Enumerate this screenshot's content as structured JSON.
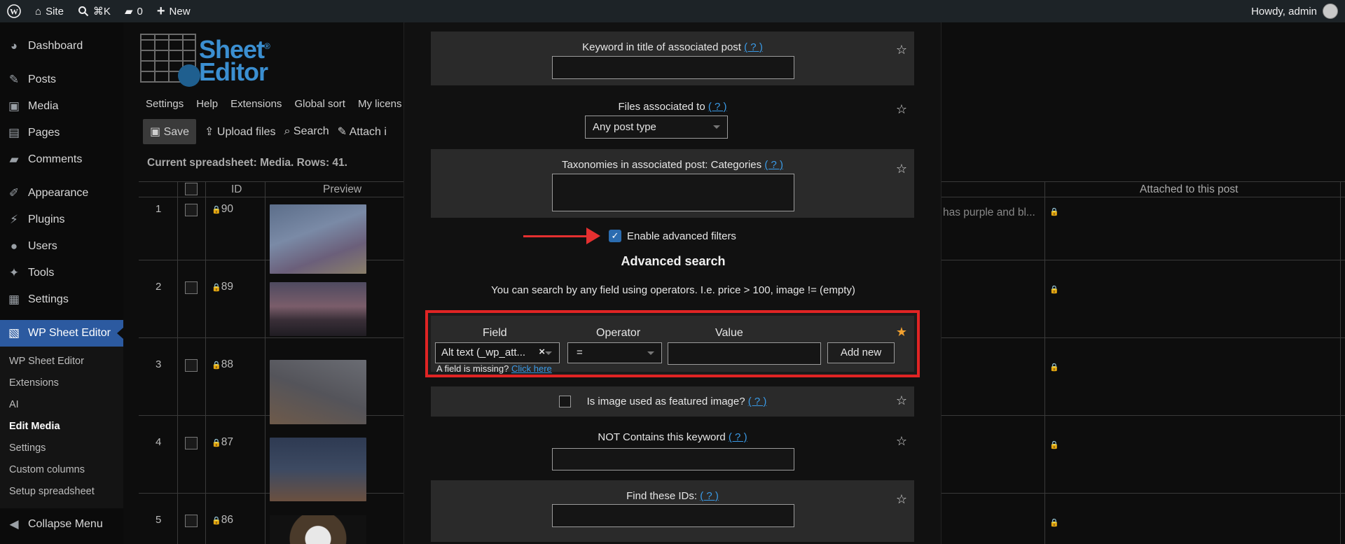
{
  "adminbar": {
    "site": "Site",
    "shortcut": "⌘K",
    "comments_count": "0",
    "new": "New",
    "howdy": "Howdy, admin"
  },
  "sidebar": {
    "items": [
      {
        "label": "Dashboard",
        "icon": "dashboard-icon",
        "glyph": "◕"
      },
      {
        "label": "Posts",
        "icon": "pin-icon",
        "glyph": "✎"
      },
      {
        "label": "Media",
        "icon": "media-icon",
        "glyph": "▣"
      },
      {
        "label": "Pages",
        "icon": "pages-icon",
        "glyph": "▤"
      },
      {
        "label": "Comments",
        "icon": "comment-icon",
        "glyph": "▰"
      },
      {
        "label": "Appearance",
        "icon": "brush-icon",
        "glyph": "✐"
      },
      {
        "label": "Plugins",
        "icon": "plug-icon",
        "glyph": "⚡"
      },
      {
        "label": "Users",
        "icon": "user-icon",
        "glyph": "●"
      },
      {
        "label": "Tools",
        "icon": "wrench-icon",
        "glyph": "✦"
      },
      {
        "label": "Settings",
        "icon": "settings-icon",
        "glyph": "▦"
      },
      {
        "label": "WP Sheet Editor",
        "icon": "sheet-editor-icon",
        "glyph": "▧"
      }
    ],
    "submenu": [
      "WP Sheet Editor",
      "Extensions",
      "AI",
      "Edit Media",
      "Settings",
      "Custom columns",
      "Setup spreadsheet"
    ],
    "collapse": "Collapse Menu"
  },
  "background": {
    "logo": {
      "line1": "Sheet",
      "line2": "Editor",
      "reg": "®"
    },
    "tabs": [
      "Settings",
      "Help",
      "Extensions",
      "Global sort",
      "My licens"
    ],
    "toolbar": {
      "save": "Save",
      "upload": "Upload files",
      "search": "Search",
      "attach": "Attach i"
    },
    "sheet_info": "Current spreadsheet: Media. Rows: 41.",
    "headers": {
      "id": "ID",
      "preview": "Preview",
      "attached": "Attached to this post"
    },
    "rows": [
      {
        "num": "1",
        "id": "90",
        "alt": "has purple and bl..."
      },
      {
        "num": "2",
        "id": "89",
        "alt": ""
      },
      {
        "num": "3",
        "id": "88",
        "alt": ""
      },
      {
        "num": "4",
        "id": "87",
        "alt": ""
      },
      {
        "num": "5",
        "id": "86",
        "alt": ""
      }
    ]
  },
  "modal": {
    "help": "( ? )",
    "keyword_title_label": "Keyword in title of associated post",
    "files_assoc_label": "Files associated to",
    "files_assoc_value": "Any post type",
    "taxonomies_label": "Taxonomies in associated post: Categories",
    "enable_advanced": "Enable advanced filters",
    "advanced_title": "Advanced search",
    "advanced_desc": "You can search by any field using operators. I.e. price > 100, image != (empty)",
    "adv": {
      "field_h": "Field",
      "operator_h": "Operator",
      "value_h": "Value",
      "field_value": "Alt text (_wp_att...",
      "operator_value": "=",
      "add_new": "Add new",
      "missing": "A field is missing?",
      "click_here": "Click here"
    },
    "featured_label": "Is image used as featured image?",
    "not_contains_label": "NOT Contains this keyword",
    "find_ids_label": "Find these IDs:"
  },
  "colors": {
    "accent": "#3a9ae6",
    "highlight": "#e02424",
    "star_active": "#f0a030"
  }
}
